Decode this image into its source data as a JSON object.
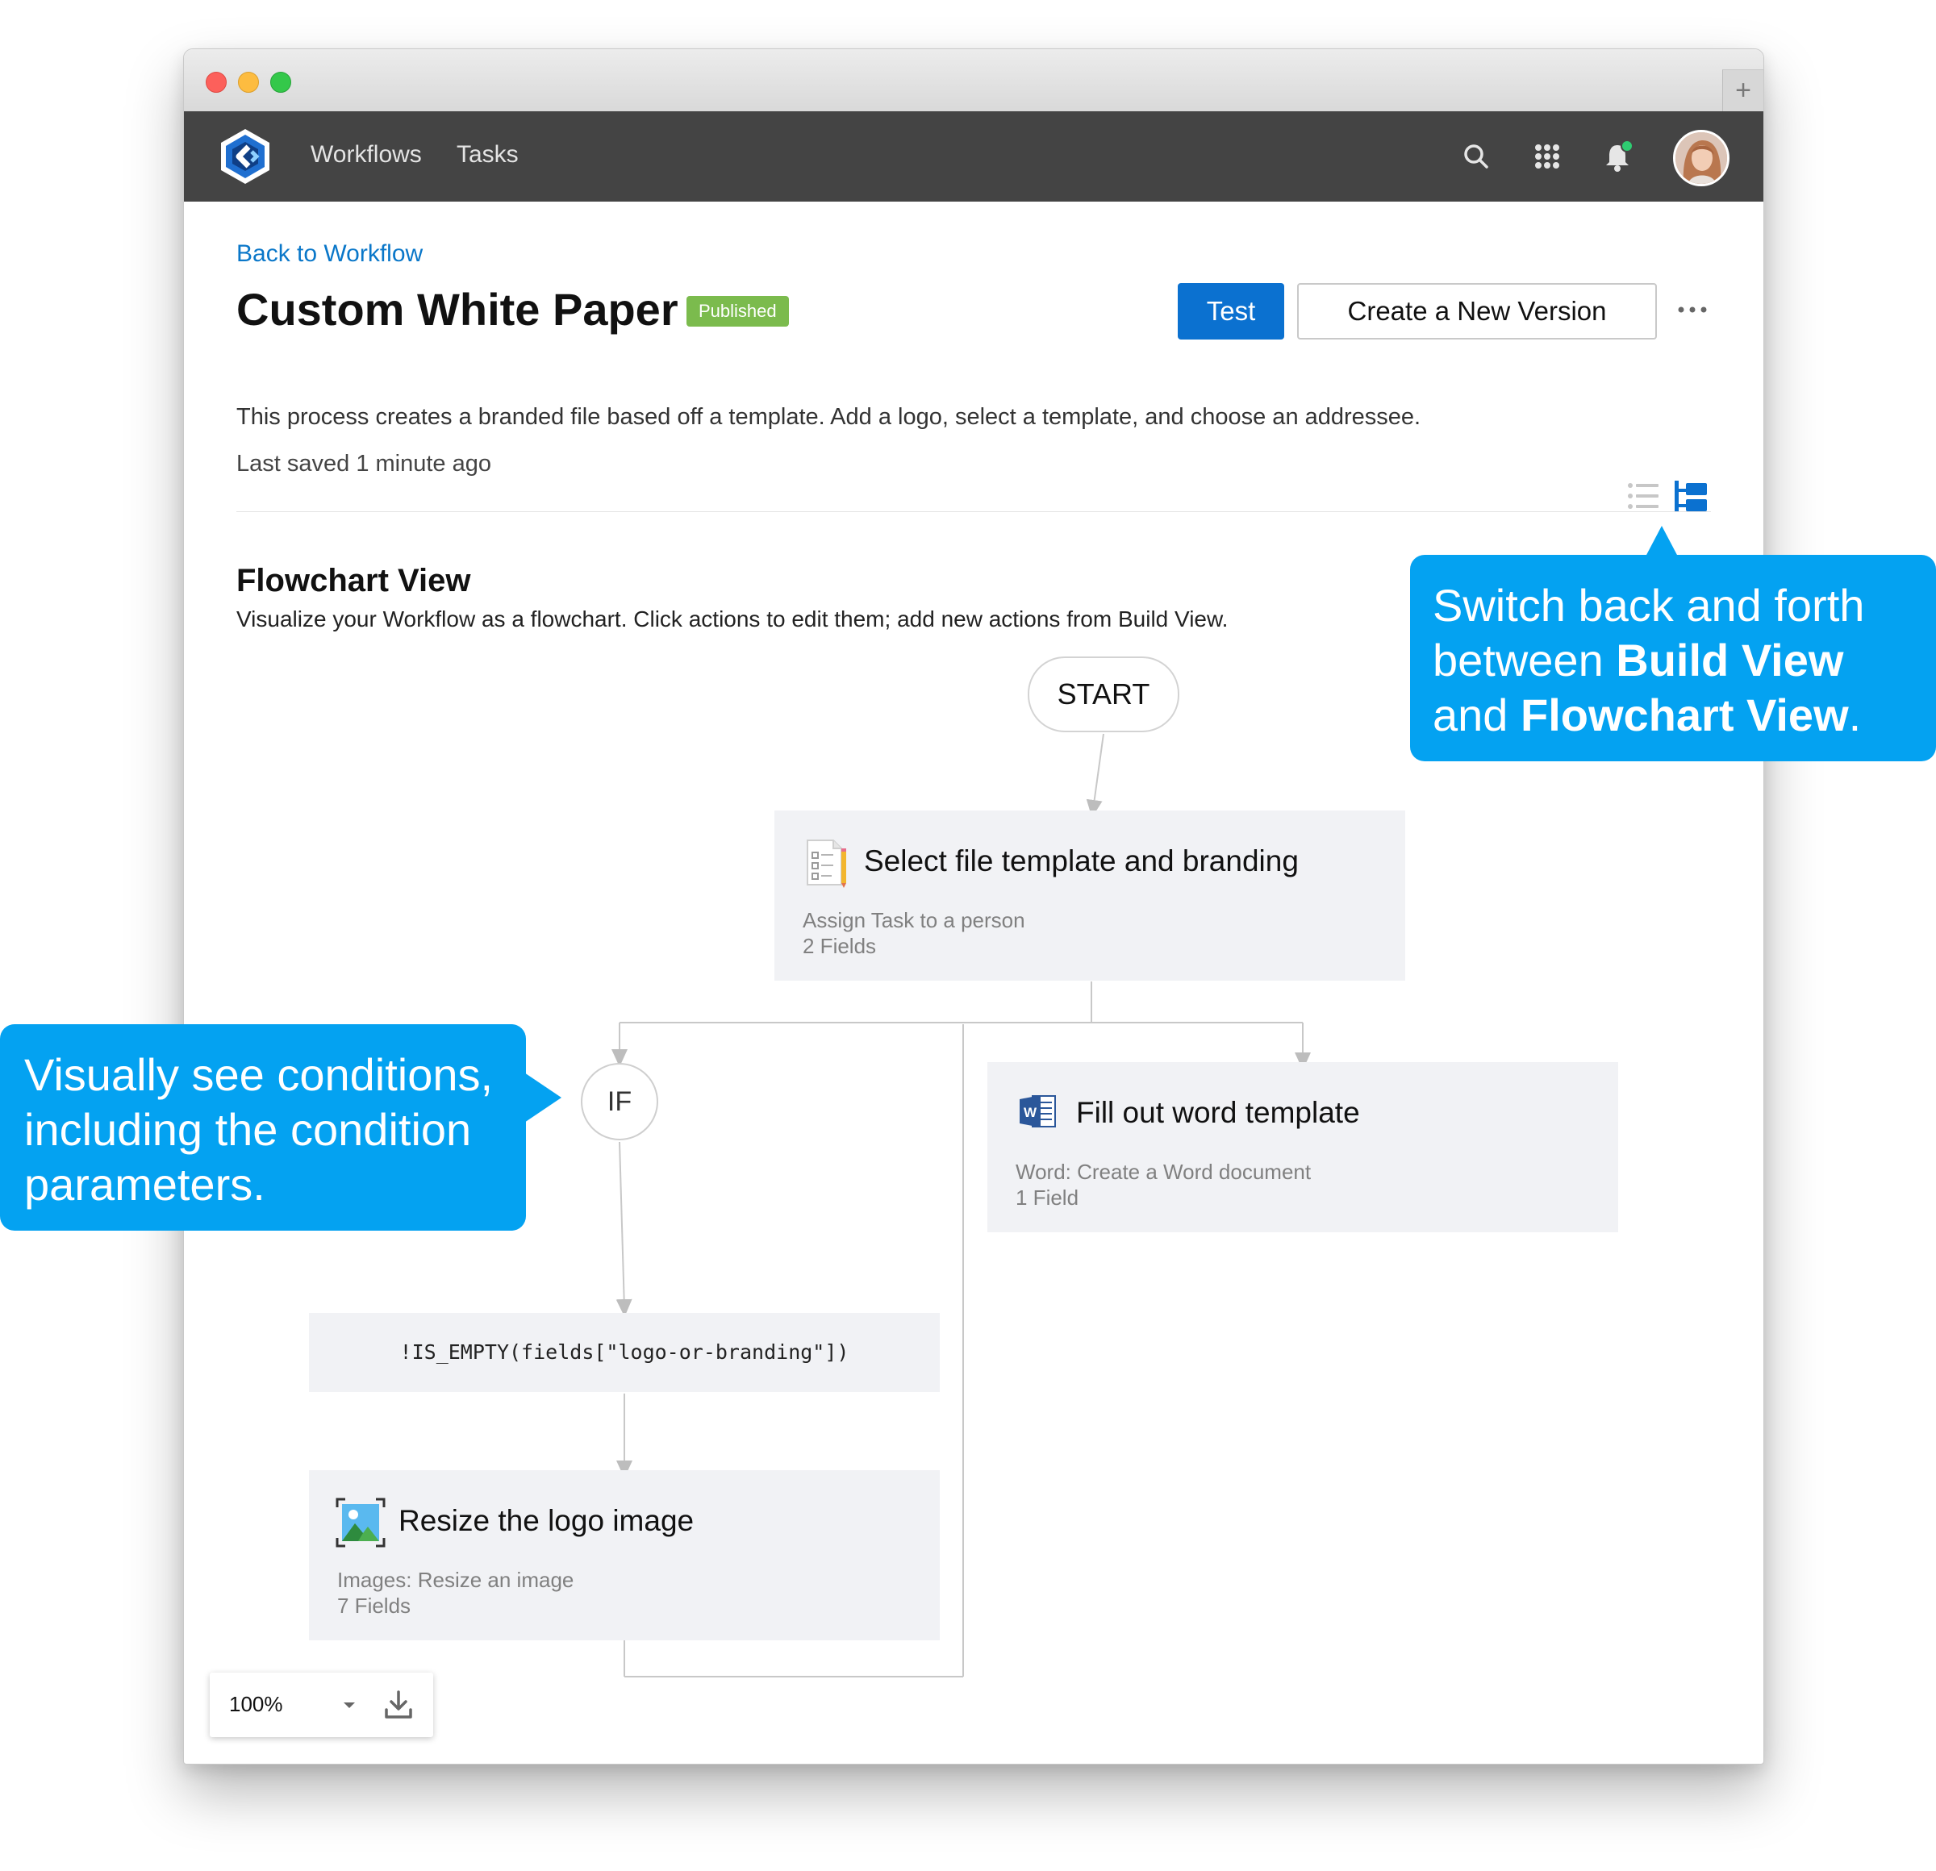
{
  "nav": {
    "links": [
      "Workflows",
      "Tasks"
    ],
    "icons": [
      "search-icon",
      "apps-grid-icon",
      "notification-bell-icon"
    ],
    "notification_dot_color": "#2ecc71"
  },
  "header": {
    "back_link": "Back to Workflow",
    "title": "Custom White Paper",
    "status_badge": "Published",
    "test_label": "Test",
    "create_version_label": "Create a New Version",
    "description": "This process creates a branded file based off a template. Add a logo, select a template, and choose an addressee.",
    "last_saved": "Last saved 1 minute ago"
  },
  "view": {
    "title": "Flowchart View",
    "subtitle": "Visualize your Workflow as a flowchart. Click actions to edit them; add new actions from Build View.",
    "active_view": "flowchart"
  },
  "flowchart": {
    "start_label": "START",
    "if_label": "IF",
    "nodes": [
      {
        "title": "Select file template and branding",
        "subtitle": "Assign Task to a person",
        "fields": "2 Fields",
        "icon": "form-task-icon"
      },
      {
        "title": "Fill out word template",
        "subtitle": "Word: Create a Word document",
        "fields": "1 Field",
        "icon": "word-icon"
      },
      {
        "title": "Resize the logo image",
        "subtitle": "Images: Resize an image",
        "fields": "7 Fields",
        "icon": "image-resize-icon"
      }
    ],
    "condition": "!IS_EMPTY(fields[\"logo-or-branding\"])"
  },
  "zoom": {
    "value": "100%"
  },
  "callouts": {
    "build_view": {
      "prefix": "Switch back and forth between ",
      "bold1": "Build View",
      "middle": " and ",
      "bold2": "Flowchart View",
      "suffix": "."
    },
    "conditions": "Visually see conditions, including the condition parameters."
  },
  "colors": {
    "primary": "#0b71d0",
    "badge": "#7bbb4d",
    "callout": "#04a2f1",
    "navbar": "#444444"
  }
}
